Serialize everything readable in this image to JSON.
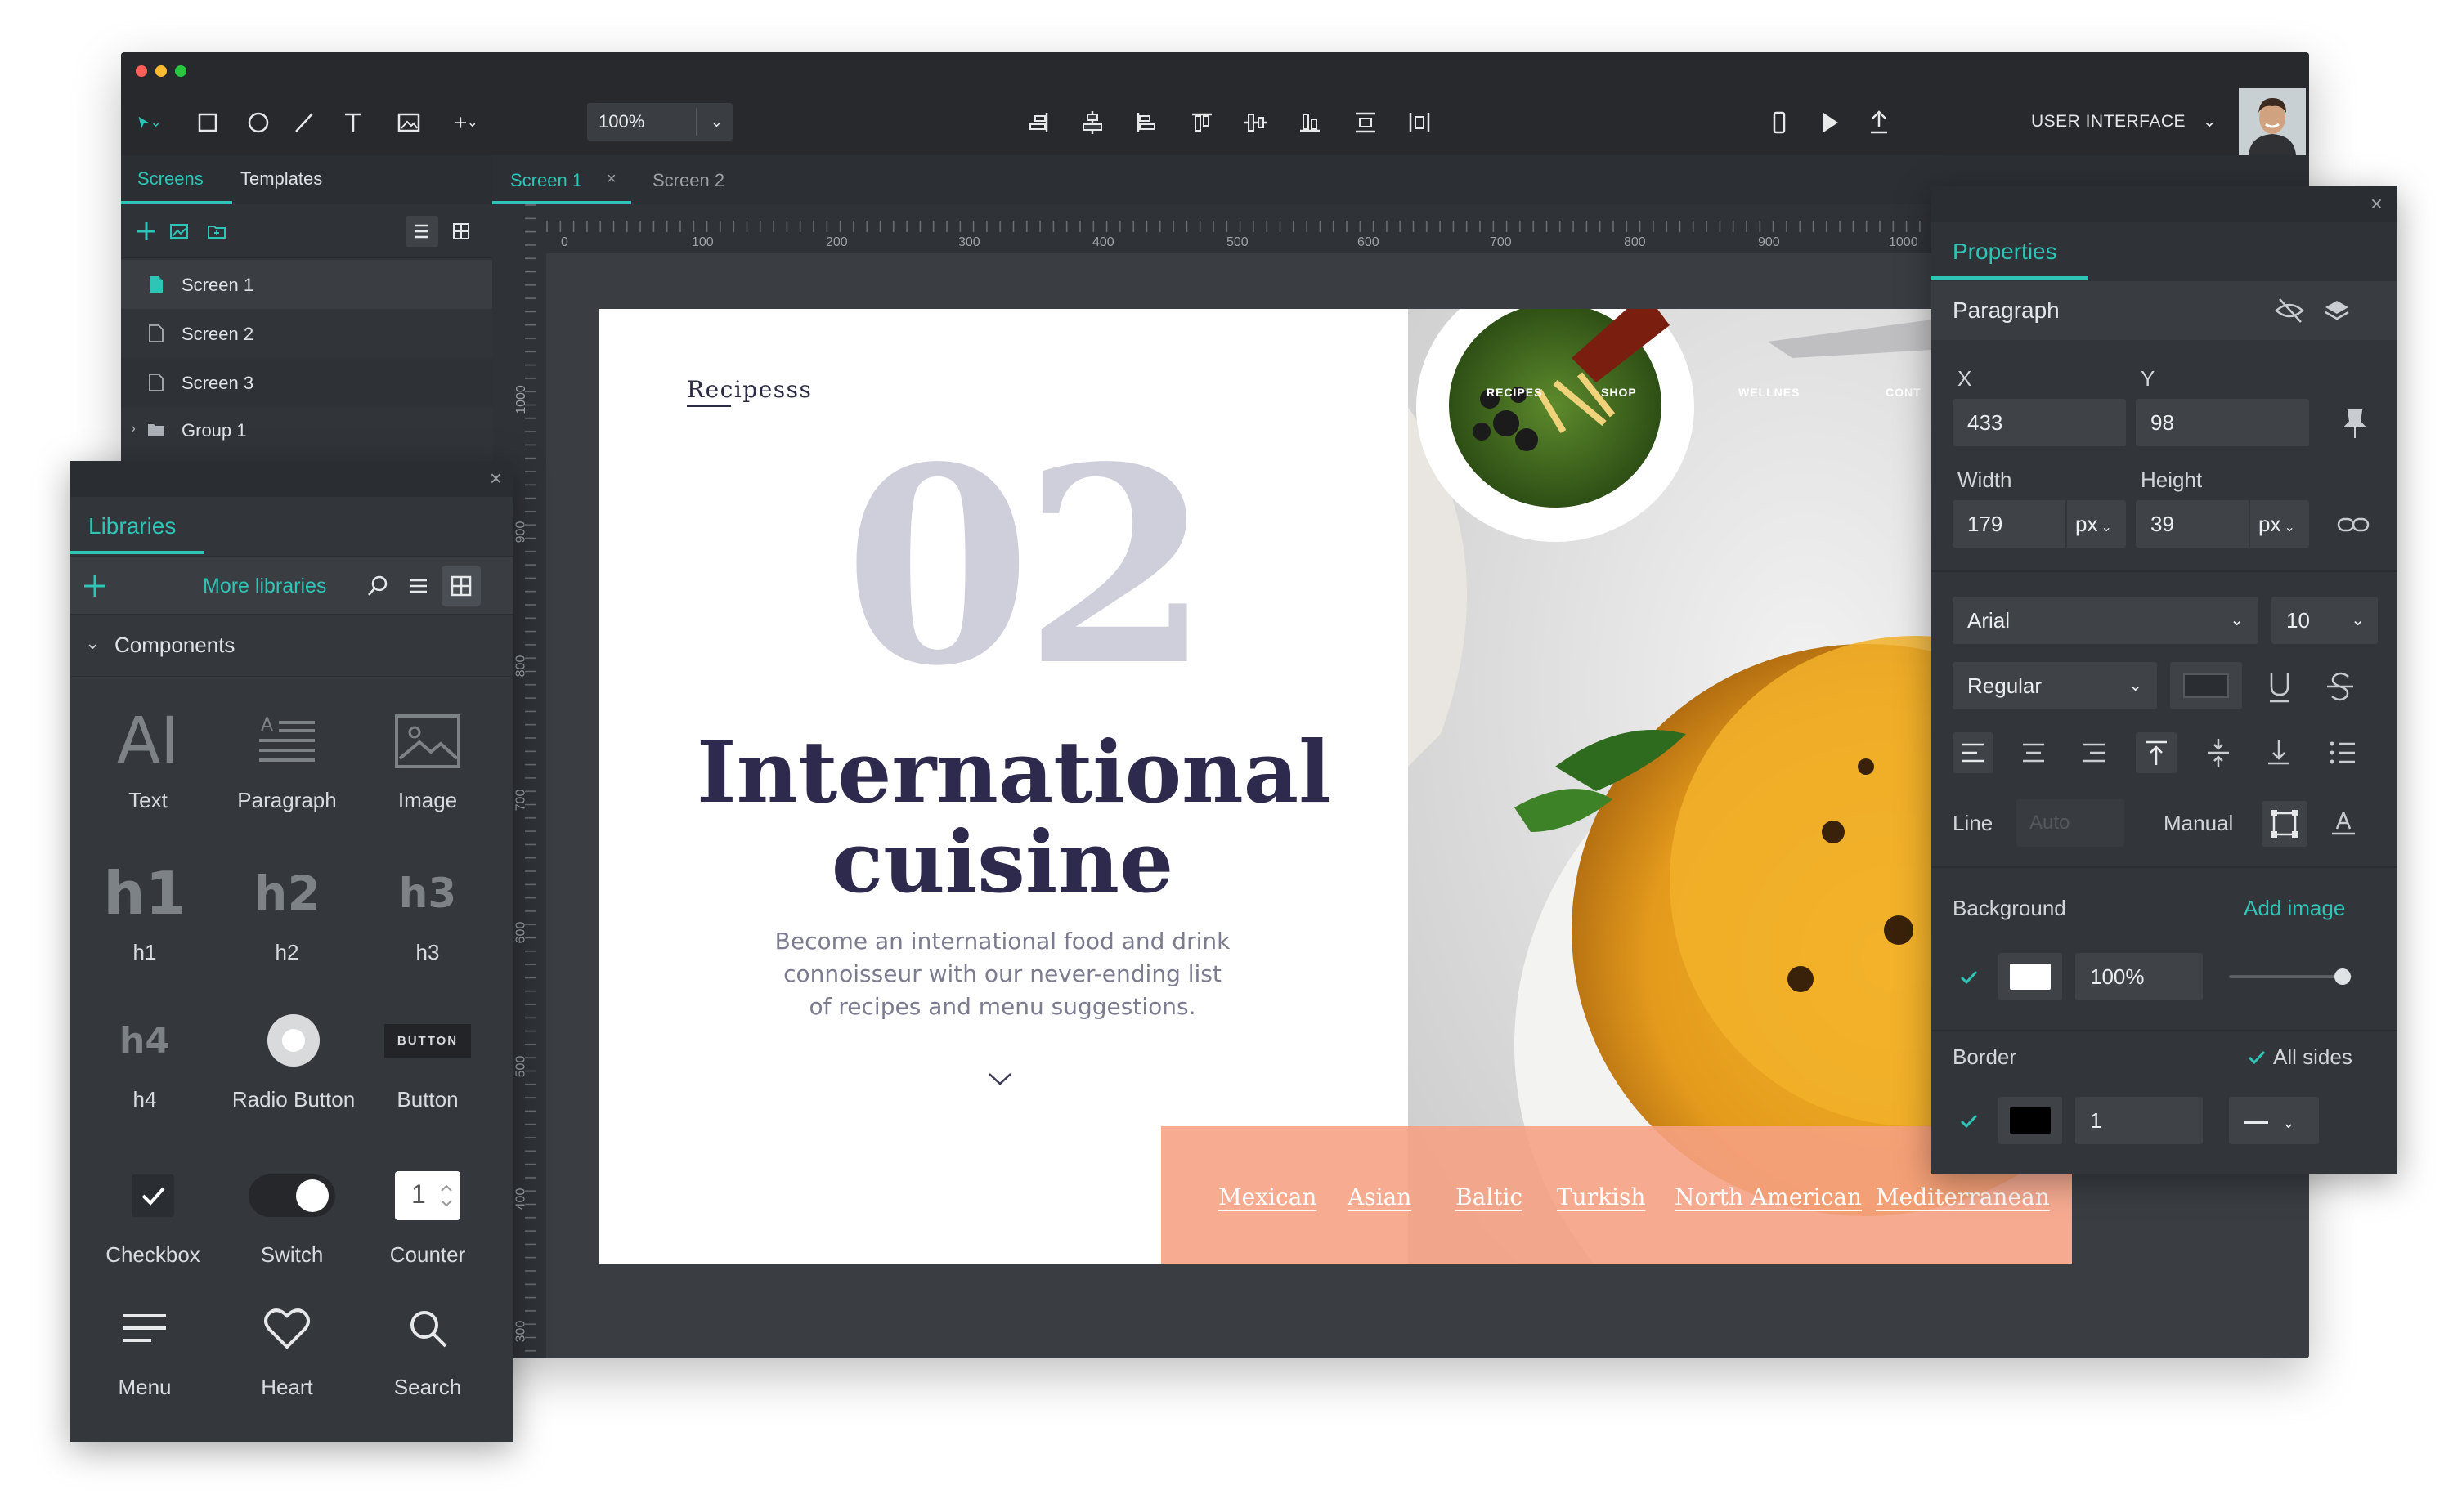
{
  "toolbar": {
    "zoom": "100%",
    "workspace_label": "USER INTERFACE"
  },
  "left_panel": {
    "tabs": [
      "Screens",
      "Templates"
    ],
    "items": [
      {
        "label": "Screen 1"
      },
      {
        "label": "Screen 2"
      },
      {
        "label": "Screen 3"
      },
      {
        "label": "Group 1"
      }
    ]
  },
  "canvas": {
    "tabs": [
      "Screen 1",
      "Screen 2"
    ],
    "ruler_h": [
      "0",
      "100",
      "200",
      "300",
      "400",
      "500",
      "600",
      "700",
      "800",
      "900",
      "1000"
    ],
    "ruler_v": [
      "1000",
      "900",
      "800",
      "700",
      "600",
      "500",
      "400",
      "300"
    ]
  },
  "design": {
    "brand": "Recipesss",
    "number": "02",
    "headline_line1": "International",
    "headline_line2": "cuisine",
    "sub_line1": "Become an international food and drink",
    "sub_line2": "connoisseur with our never-ending list",
    "sub_line3": "of recipes and menu suggestions.",
    "nav": [
      "RECIPES",
      "SHOP",
      "WELLNES",
      "CONT"
    ],
    "categories": [
      "Mexican",
      "Asian",
      "Baltic",
      "Turkish",
      "North American",
      "Mediterranean"
    ],
    "accent_color": "#f6a083"
  },
  "libraries": {
    "title": "Libraries",
    "more": "More libraries",
    "section": "Components",
    "components": [
      {
        "label": "Text",
        "icon": "text-ai-icon"
      },
      {
        "label": "Paragraph",
        "icon": "paragraph-icon"
      },
      {
        "label": "Image",
        "icon": "image-icon"
      },
      {
        "label": "h1",
        "glyph": "h1"
      },
      {
        "label": "h2",
        "glyph": "h2"
      },
      {
        "label": "h3",
        "glyph": "h3"
      },
      {
        "label": "h4",
        "glyph": "h4"
      },
      {
        "label": "Radio Button",
        "icon": "radio-icon"
      },
      {
        "label": "Button",
        "icon": "button-icon",
        "glyph": "BUTTON"
      },
      {
        "label": "Checkbox",
        "icon": "checkbox-icon"
      },
      {
        "label": "Switch",
        "icon": "switch-icon"
      },
      {
        "label": "Counter",
        "icon": "counter-icon",
        "glyph": "1"
      },
      {
        "label": "Menu",
        "icon": "menu-icon"
      },
      {
        "label": "Heart",
        "icon": "heart-icon"
      },
      {
        "label": "Search",
        "icon": "search-icon"
      }
    ]
  },
  "properties": {
    "title": "Properties",
    "element": "Paragraph",
    "x_label": "X",
    "x": "433",
    "y_label": "Y",
    "y": "98",
    "width_label": "Width",
    "width": "179",
    "width_unit": "px",
    "height_label": "Height",
    "height": "39",
    "height_unit": "px",
    "font": "Arial",
    "size": "10",
    "weight": "Regular",
    "line_label": "Line",
    "line_placeholder": "Auto",
    "manual_label": "Manual",
    "background_label": "Background",
    "add_image": "Add image",
    "opacity": "100%",
    "opacity_level": 1.0,
    "border_label": "Border",
    "all_sides": "All sides",
    "border_width": "1",
    "teal": "#2ec4b6"
  }
}
